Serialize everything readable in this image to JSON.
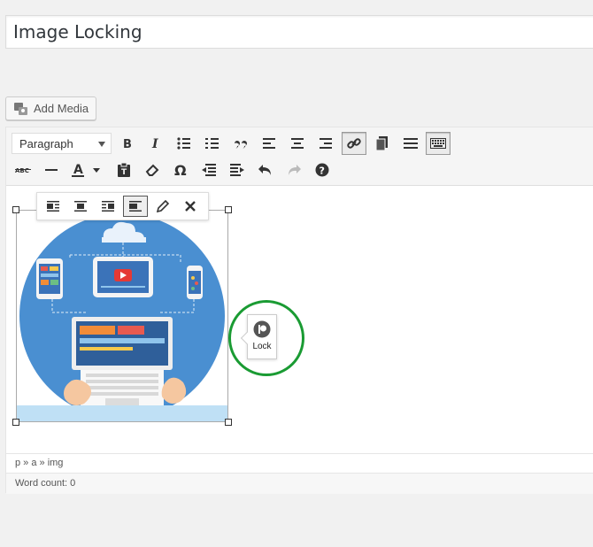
{
  "post": {
    "title": "Image Locking"
  },
  "media": {
    "add_label": "Add Media"
  },
  "toolbar": {
    "format_select": "Paragraph"
  },
  "image_toolbar": {
    "buttons": [
      "align-left",
      "align-center",
      "align-right",
      "no-align",
      "edit",
      "remove"
    ]
  },
  "lock_popover": {
    "label": "Lock"
  },
  "status": {
    "path": "p » a » img",
    "word_count": "Word count: 0"
  },
  "colors": {
    "accent": "#0073aa",
    "highlight_circle": "#1a9b33",
    "illustration_bg": "#4a8fd1"
  }
}
